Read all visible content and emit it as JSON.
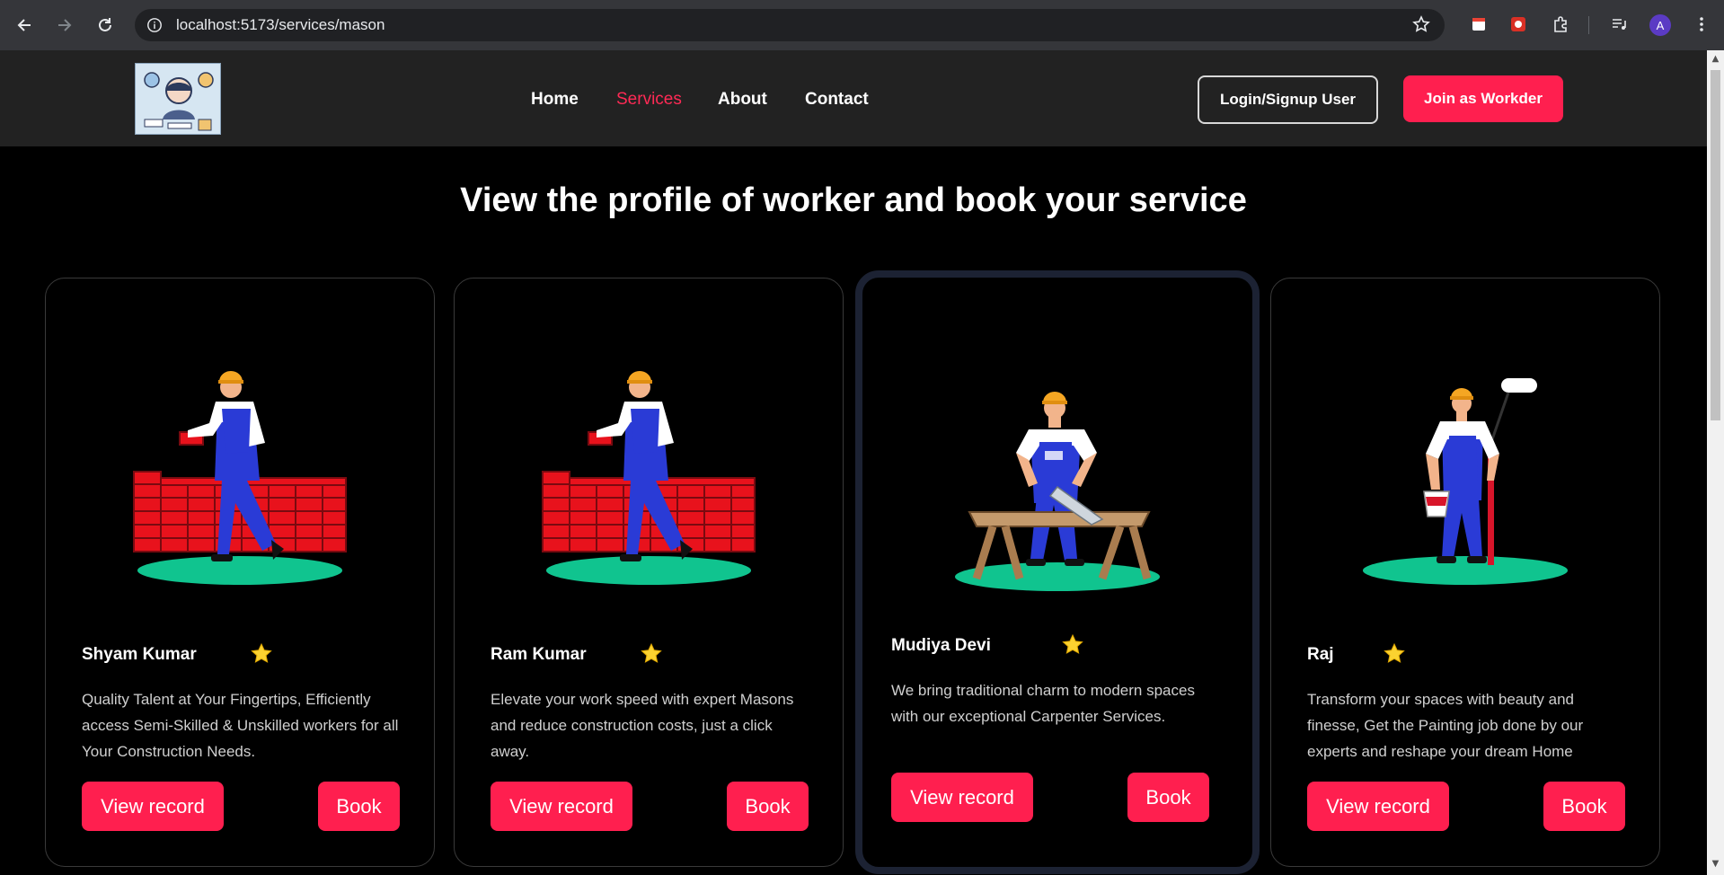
{
  "browser": {
    "url": "localhost:5173/services/mason",
    "avatar_letter": "A"
  },
  "header": {
    "logo_alt": "logo",
    "nav": [
      {
        "label": "Home",
        "active": false
      },
      {
        "label": "Services",
        "active": true
      },
      {
        "label": "About",
        "active": false
      },
      {
        "label": "Contact",
        "active": false
      }
    ],
    "login_label": "Login/Signup User",
    "join_label": "Join as Workder"
  },
  "main": {
    "title": "View the profile of worker and book your service",
    "workers": [
      {
        "name": "Shyam Kumar",
        "illustration": "mason-bricklayer",
        "description": "Quality Talent at Your Fingertips, Efficiently access Semi-Skilled & Unskilled workers for all Your Construction Needs.",
        "view_label": "View record",
        "book_label": "Book"
      },
      {
        "name": "Ram Kumar",
        "illustration": "mason-bricklayer",
        "description": "Elevate your work speed with expert Masons and reduce construction costs, just a click away.",
        "view_label": "View record",
        "book_label": "Book"
      },
      {
        "name": "Mudiya Devi",
        "illustration": "carpenter-sawing",
        "description": "We bring traditional charm to modern spaces with our exceptional Carpenter Services.",
        "view_label": "View record",
        "book_label": "Book"
      },
      {
        "name": "Raj",
        "illustration": "painter-roller",
        "description": "Transform your spaces with beauty and finesse, Get the Painting job done by our experts and reshape your dream Home",
        "view_label": "View record",
        "book_label": "Book"
      }
    ]
  },
  "colors": {
    "accent": "#ff1f4f",
    "header_bg": "#222222",
    "page_bg": "#000000",
    "star": "#fbd230",
    "ground": "#10c48f",
    "brick": "#e8121c",
    "overall": "#2a3bd6"
  }
}
